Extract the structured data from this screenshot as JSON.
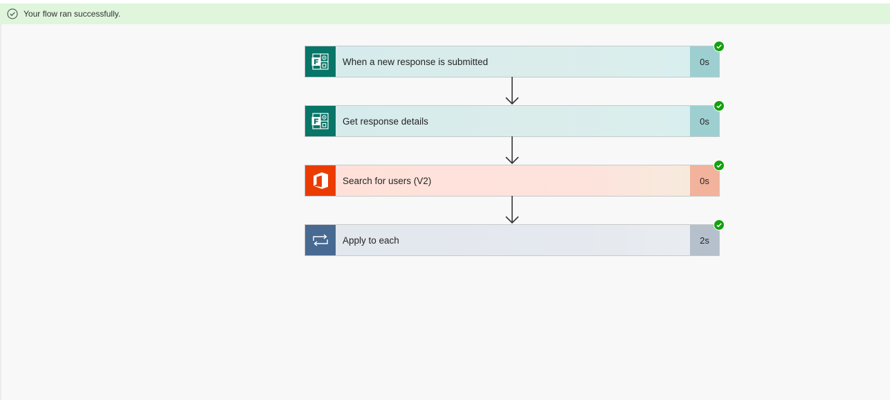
{
  "banner": {
    "message": "Your flow ran successfully.",
    "icon": "success-check-circle-icon",
    "color": "#dff6dd"
  },
  "steps": [
    {
      "title": "When a new response is submitted",
      "duration": "0s",
      "icon": "microsoft-forms-icon",
      "status": "succeeded",
      "accent": "#077568"
    },
    {
      "title": "Get response details",
      "duration": "0s",
      "icon": "microsoft-forms-icon",
      "status": "succeeded",
      "accent": "#077568"
    },
    {
      "title": "Search for users (V2)",
      "duration": "0s",
      "icon": "office-365-icon",
      "status": "succeeded",
      "accent": "#eb3c00"
    },
    {
      "title": "Apply to each",
      "duration": "2s",
      "icon": "loop-icon",
      "status": "succeeded",
      "accent": "#486991"
    }
  ],
  "colors": {
    "success": "#13a10e",
    "arrow": "#333333"
  }
}
